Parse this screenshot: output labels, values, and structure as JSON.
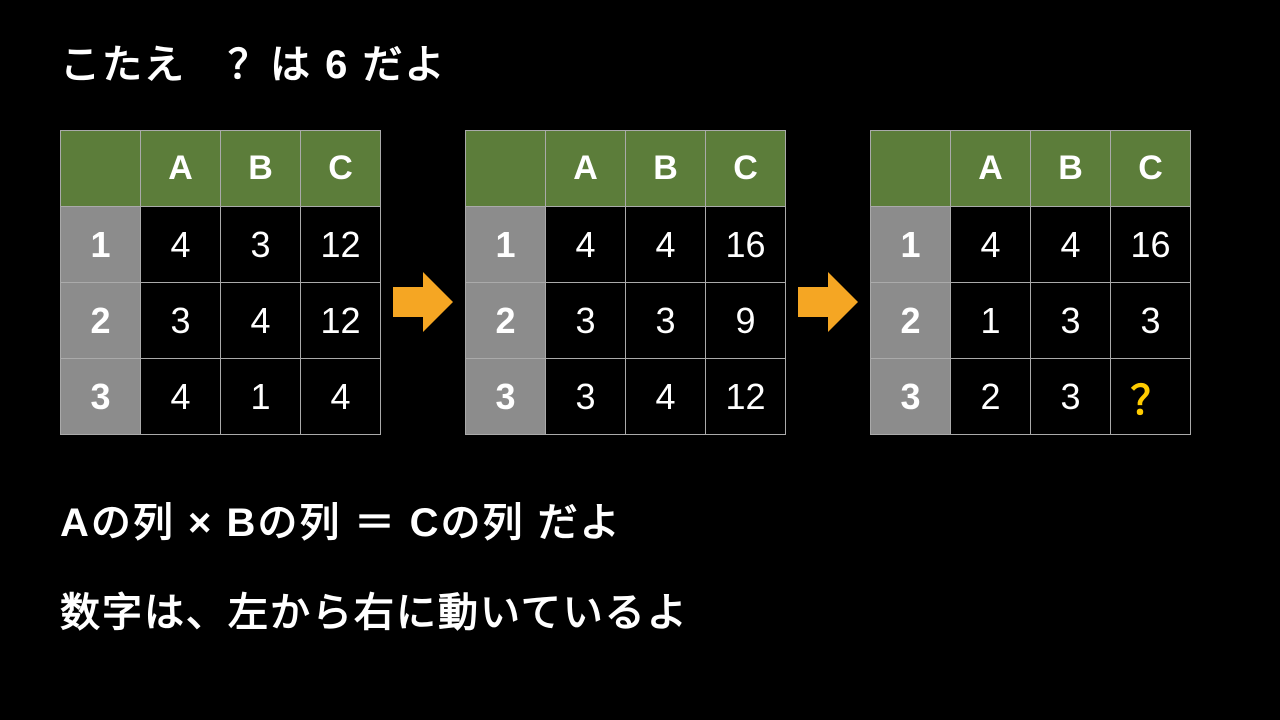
{
  "title": "こたえ　？は 6 だよ",
  "columns": [
    "A",
    "B",
    "C"
  ],
  "rows": [
    "1",
    "2",
    "3"
  ],
  "table1": [
    [
      "4",
      "3",
      "12"
    ],
    [
      "3",
      "4",
      "12"
    ],
    [
      "4",
      "1",
      "4"
    ]
  ],
  "table2": [
    [
      "4",
      "4",
      "16"
    ],
    [
      "3",
      "3",
      "9"
    ],
    [
      "3",
      "4",
      "12"
    ]
  ],
  "table3": [
    [
      "4",
      "4",
      "16"
    ],
    [
      "1",
      "3",
      "3"
    ],
    [
      "2",
      "3",
      "？"
    ]
  ],
  "explain1": "Aの列 × Bの列 ＝ Cの列 だよ",
  "explain2": "数字は、左から右に動いているよ"
}
